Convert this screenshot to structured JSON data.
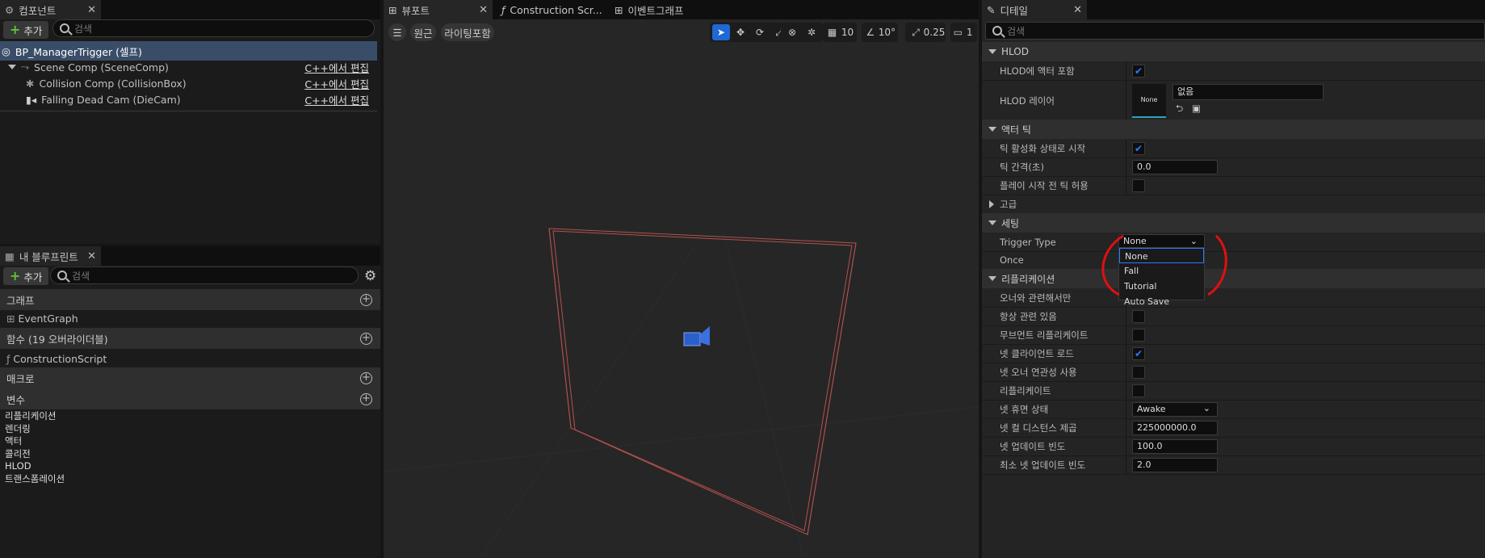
{
  "components": {
    "tab": "컴포넌트",
    "add": "추가",
    "search": "검색",
    "self": "BP_ManagerTrigger (셀프)",
    "items": [
      {
        "name": "Scene Comp (SceneComp)",
        "edit": "C++에서 편집"
      },
      {
        "name": "Collision Comp (CollisionBox)",
        "edit": "C++에서 편집"
      },
      {
        "name": "Falling Dead Cam (DieCam)",
        "edit": "C++에서 편집"
      }
    ]
  },
  "blueprint": {
    "tab": "내 블루프린트",
    "add": "추가",
    "search": "검색",
    "graphs": "그래프",
    "eventgraph": "EventGraph",
    "functions": "함수 (19 오버라이더블)",
    "construction": "ConstructionScript",
    "macros": "매크로",
    "variables": "변수",
    "categories": [
      "리플리케이션",
      "렌더링",
      "액터",
      "콜리전",
      "HLOD",
      "트랜스폼레이션"
    ]
  },
  "viewport": {
    "tabs": [
      "뷰포트",
      "Construction Scr...",
      "이벤트그래프"
    ],
    "perspective": "원근",
    "lighting": "라이팅포함",
    "grid": "10",
    "angle": "10°",
    "scale": "0.25",
    "cam": "1"
  },
  "details": {
    "tab": "디테일",
    "search": "검색",
    "hlod": "HLOD",
    "hlod_include": "HLOD에 액터 포함",
    "hlod_layer": "HLOD 레이어",
    "none_thumb": "None",
    "none_value": "없음",
    "actor_tick": "액터 틱",
    "tick_start": "틱 활성화 상태로 시작",
    "tick_interval": "틱 간격(초)",
    "tick_interval_val": "0.0",
    "tick_before": "플레이 시작 전 틱 허용",
    "advanced": "고급",
    "settings": "세팅",
    "trigger_type": "Trigger Type",
    "trigger_val": "None",
    "once": "Once",
    "options": [
      "None",
      "Fall",
      "Tutorial",
      "Auto Save"
    ],
    "replication": "리플리케이션",
    "owner_only": "오너와 관련해서만",
    "always_rel": "항상 관련 있음",
    "movement_rep": "무브먼트 리플리케이트",
    "net_load": "넷 클라이언트 로드",
    "net_owner": "넷 오너 연관성 사용",
    "replicates": "리플리케이트",
    "dormancy": "넷 휴면 상태",
    "dormancy_val": "Awake",
    "cull": "넷 컬 디스턴스 제곱",
    "cull_val": "225000000.0",
    "freq": "넷 업데이트 빈도",
    "freq_val": "100.0",
    "minfreq": "최소 넷 업데이트 빈도",
    "minfreq_val": "2.0"
  }
}
